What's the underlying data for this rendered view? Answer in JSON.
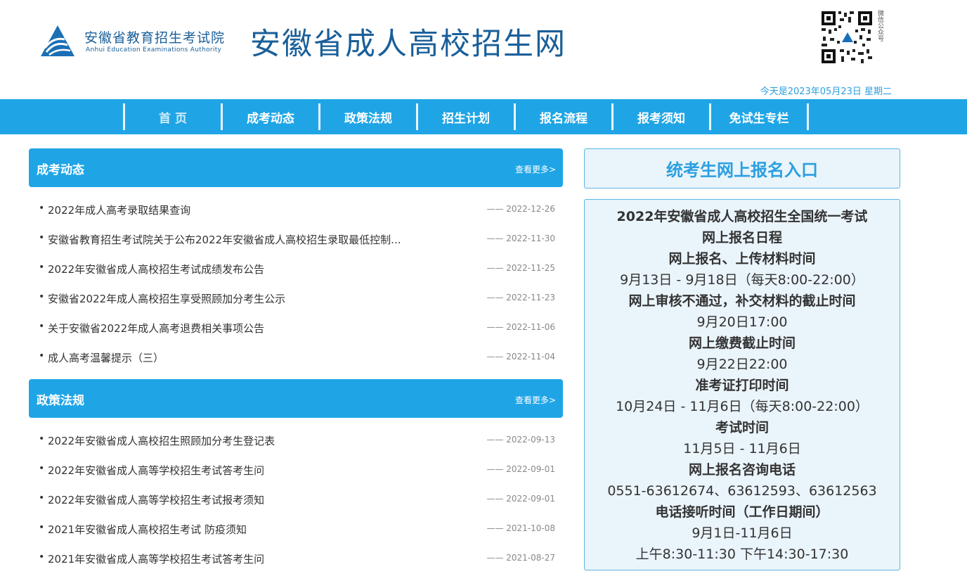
{
  "header": {
    "org_cn": "安徽省教育招生考试院",
    "org_en": "Anhui Education Examinations Authority",
    "site_title": "安徽省成人高校招生网",
    "qr_label": "微信公众号",
    "date": "今天是2023年05月23日 星期二"
  },
  "nav": [
    "首 页",
    "成考动态",
    "政策法规",
    "招生计划",
    "报名流程",
    "报考须知",
    "免试生专栏"
  ],
  "sections": [
    {
      "title": "成考动态",
      "more": "查看更多>",
      "items": [
        {
          "title": "2022年成人高考录取结果查询",
          "date": "—— 2022-12-26"
        },
        {
          "title": "安徽省教育招生考试院关于公布2022年安徽省成人高校招生录取最低控制...",
          "date": "—— 2022-11-30"
        },
        {
          "title": "2022年安徽省成人高校招生考试成绩发布公告",
          "date": "—— 2022-11-25"
        },
        {
          "title": "安徽省2022年成人高校招生享受照顾加分考生公示",
          "date": "—— 2022-11-23"
        },
        {
          "title": "关于安徽省2022年成人高考退费相关事项公告",
          "date": "—— 2022-11-06"
        },
        {
          "title": "成人高考温馨提示（三）",
          "date": "—— 2022-11-04"
        }
      ]
    },
    {
      "title": "政策法规",
      "more": "查看更多>",
      "items": [
        {
          "title": "2022年安徽省成人高校招生照顾加分考生登记表",
          "date": "—— 2022-09-13"
        },
        {
          "title": "2022年安徽省成人高等学校招生考试答考生问",
          "date": "—— 2022-09-01"
        },
        {
          "title": "2022年安徽省成人高等学校招生考试报考须知",
          "date": "—— 2022-09-01"
        },
        {
          "title": "2021年安徽省成人高校招生考试 防疫须知",
          "date": "—— 2021-10-08"
        },
        {
          "title": "2021年安徽省成人高等学校招生考试答考生问",
          "date": "—— 2021-08-27"
        }
      ]
    }
  ],
  "entry": "统考生网上报名入口",
  "schedule": [
    {
      "text": "2022年安徽省成人高校招生全国统一考试",
      "bold": true
    },
    {
      "text": "网上报名日程",
      "bold": true
    },
    {
      "text": "网上报名、上传材料时间",
      "bold": true
    },
    {
      "text": "9月13日 - 9月18日（每天8:00-22:00）",
      "bold": false
    },
    {
      "text": "网上审核不通过，补交材料的截止时间",
      "bold": true
    },
    {
      "text": "9月20日17:00",
      "bold": false
    },
    {
      "text": "网上缴费截止时间",
      "bold": true
    },
    {
      "text": "9月22日22:00",
      "bold": false
    },
    {
      "text": "准考证打印时间",
      "bold": true
    },
    {
      "text": "10月24日 - 11月6日（每天8:00-22:00）",
      "bold": false
    },
    {
      "text": "考试时间",
      "bold": true
    },
    {
      "text": "11月5日 - 11月6日",
      "bold": false
    },
    {
      "text": "网上报名咨询电话",
      "bold": true
    },
    {
      "text": "0551-63612674、63612593、63612563",
      "bold": false
    },
    {
      "text": "电话接听时间（工作日期间）",
      "bold": true
    },
    {
      "text": "9月1日-11月6日",
      "bold": false
    },
    {
      "text": "上午8:30-11:30 下午14:30-17:30",
      "bold": false
    }
  ],
  "colors": {
    "primary": "#1fa5e6",
    "brand": "#1a5f99",
    "panel_bg": "#eaf4fb"
  }
}
